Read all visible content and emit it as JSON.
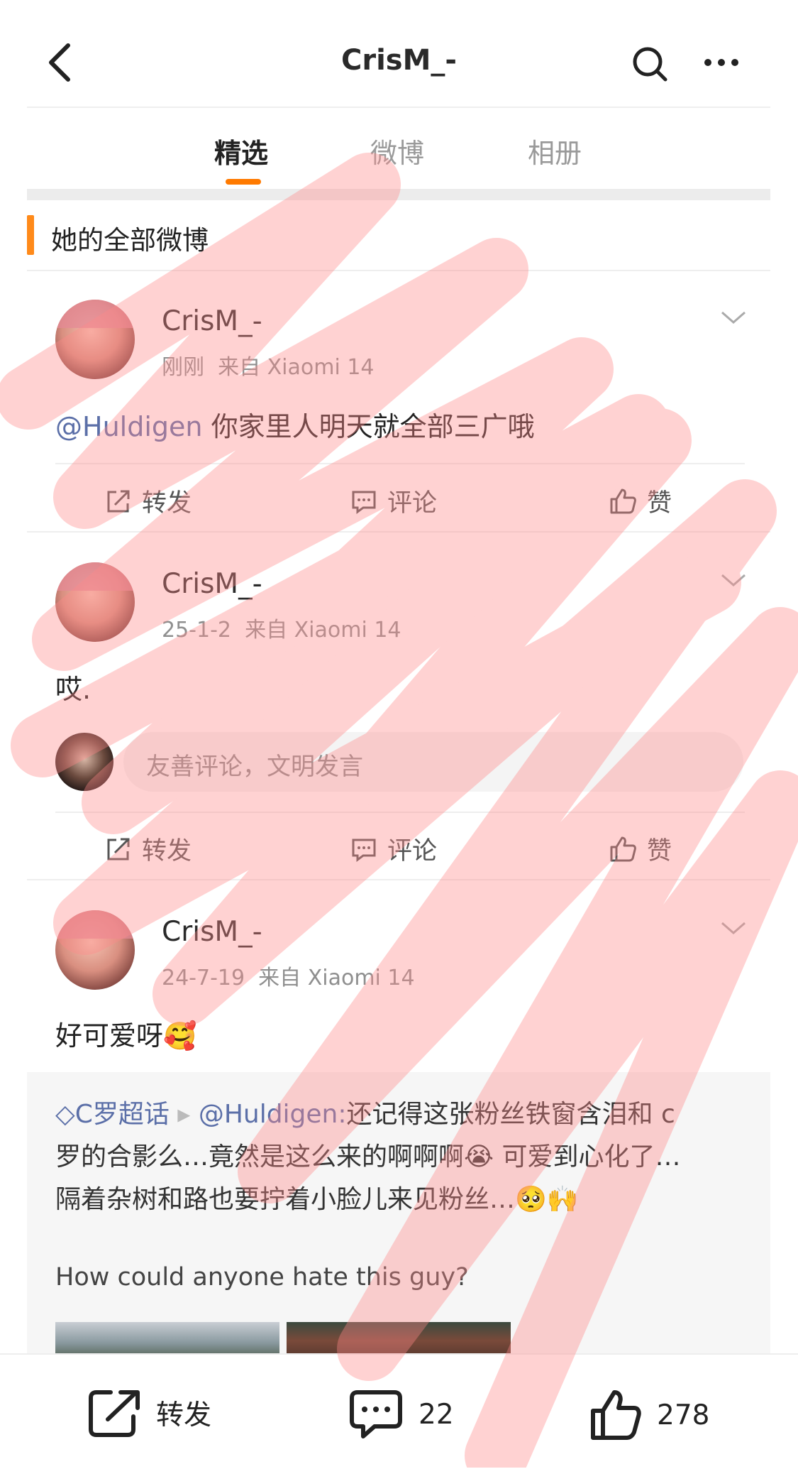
{
  "header": {
    "title": "CrisM_-",
    "icons": [
      "back-arrow-icon",
      "search-icon",
      "more-icon"
    ]
  },
  "tabs": [
    {
      "label": "精选",
      "active": true
    },
    {
      "label": "微博",
      "active": false
    },
    {
      "label": "相册",
      "active": false
    }
  ],
  "section_title": "她的全部微博",
  "posts": [
    {
      "author": "CrisM_-",
      "time": "刚刚",
      "source": "来自 Xiaomi 14",
      "mention": "@Huldigen",
      "text": " 你家里人明天就全部三广哦",
      "actions": {
        "repost": "转发",
        "comment": "评论",
        "like": "赞"
      }
    },
    {
      "author": "CrisM_-",
      "time": "25-1-2",
      "source": "来自 Xiaomi 14",
      "text": "哎.",
      "comment_placeholder": "友善评论，文明发言",
      "actions": {
        "repost": "转发",
        "comment": "评论",
        "like": "赞"
      }
    },
    {
      "author": "CrisM_-",
      "time": "24-7-19",
      "source": "来自 Xiaomi 14",
      "text": "好可爱呀🥰",
      "repost": {
        "supertopic": "C罗超话",
        "mention": "@Huldigen:",
        "line1": "还记得这张粉丝铁窗含泪和 c",
        "line2": "罗的合影么…竟然是这么来的啊啊啊😭 可爱到心化了…",
        "line3": "隔着杂树和路也要拧着小脸儿来见粉丝…🥺🙌",
        "english": "How could anyone hate this guy?"
      }
    }
  ],
  "bottom_bar": {
    "repost": "转发",
    "comments": "22",
    "likes": "278"
  },
  "colors": {
    "accent": "#ff7a00",
    "mention": "#5b6fa8",
    "scribble": "#ff8a8a"
  }
}
